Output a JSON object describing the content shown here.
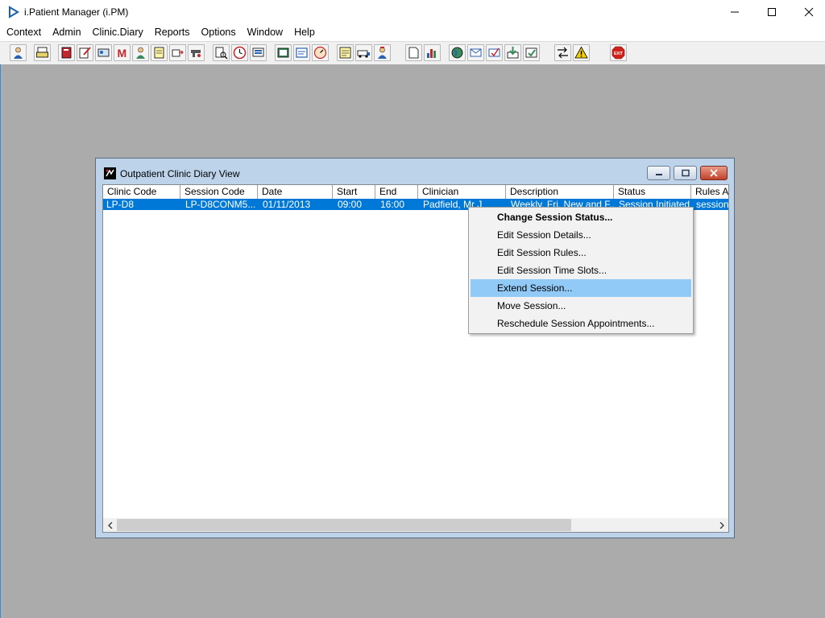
{
  "app": {
    "title": "i.Patient Manager (i.PM)"
  },
  "menubar": [
    "Context",
    "Admin",
    "Clinic.Diary",
    "Reports",
    "Options",
    "Window",
    "Help"
  ],
  "toolbar": {
    "buttons": [
      {
        "icon": "patient-icon"
      },
      {
        "icon": "printer-icon"
      },
      {
        "icon": "book-icon"
      },
      {
        "icon": "referral-icon"
      },
      {
        "icon": "id-card-icon"
      },
      {
        "icon": "m-letter-icon"
      },
      {
        "icon": "doctor-icon"
      },
      {
        "icon": "notepad-icon"
      },
      {
        "icon": "transfer-icon"
      },
      {
        "icon": "gun-icon"
      },
      {
        "icon": "search-doc-icon"
      },
      {
        "icon": "clock-icon"
      },
      {
        "icon": "monitor-icon"
      },
      {
        "icon": "photo-icon"
      },
      {
        "icon": "card-icon"
      },
      {
        "icon": "dial-icon"
      },
      {
        "icon": "note-icon"
      },
      {
        "icon": "ambulance-icon"
      },
      {
        "icon": "nurse-icon"
      },
      {
        "icon": "document-icon"
      },
      {
        "icon": "bar-chart-icon"
      },
      {
        "icon": "globe-icon"
      },
      {
        "icon": "mail-check-icon"
      },
      {
        "icon": "mail-tick-icon"
      },
      {
        "icon": "download-icon"
      },
      {
        "icon": "refresh-icon"
      },
      {
        "icon": "arrows-icon"
      },
      {
        "icon": "warning-icon"
      },
      {
        "icon": "exit-icon"
      }
    ],
    "exit_label": "EXIT"
  },
  "child_window": {
    "title": "Outpatient Clinic Diary View",
    "columns": [
      "Clinic Code",
      "Session Code",
      "Date",
      "Start",
      "End",
      "Clinician",
      "Description",
      "Status",
      "Rules Ap"
    ],
    "rows": [
      [
        "LP-D8",
        "LP-D8CONM5...",
        "01/11/2013",
        "09:00",
        "16:00",
        "Padfield, Mr J",
        "Weekly, Fri, New and F...",
        "Session Initiated",
        "session"
      ]
    ]
  },
  "context_menu": {
    "items": [
      {
        "label": "Change Session Status...",
        "bold": true
      },
      {
        "label": "Edit Session Details..."
      },
      {
        "label": "Edit Session Rules..."
      },
      {
        "label": "Edit Session Time Slots..."
      },
      {
        "label": "Extend Session...",
        "highlighted": true
      },
      {
        "label": "Move Session..."
      },
      {
        "label": "Reschedule Session Appointments..."
      }
    ]
  },
  "colors": {
    "accent": "#0078d7",
    "highlight": "#91c9f7",
    "workspace": "#ababab"
  }
}
